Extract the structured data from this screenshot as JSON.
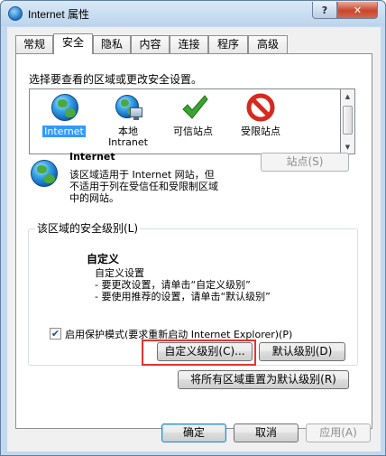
{
  "window": {
    "title": "Internet 属性",
    "help_label": "?",
    "close_label": "✕"
  },
  "tabs": [
    "常规",
    "安全",
    "隐私",
    "内容",
    "连接",
    "程序",
    "高级"
  ],
  "active_tab": "安全",
  "security": {
    "zone_prompt": "选择要查看的区域或更改安全设置。",
    "zones": [
      {
        "label_line1": "Internet",
        "label_line2": "",
        "icon": "globe-icon",
        "selected": true
      },
      {
        "label_line1": "本地",
        "label_line2": "Intranet",
        "icon": "local-intranet-icon",
        "selected": false
      },
      {
        "label_line1": "可信站点",
        "label_line2": "",
        "icon": "green-check-icon",
        "selected": false
      },
      {
        "label_line1": "受限站点",
        "label_line2": "",
        "icon": "restricted-icon",
        "selected": false
      }
    ],
    "selected_zone": {
      "name": "Internet",
      "description": [
        "该区域适用于 Internet 网站，但",
        "不适用于列在受信任和受限制区域",
        "中的网站。"
      ]
    },
    "sites_button": "站点(S)",
    "level_group": {
      "title": "该区域的安全级别(L)",
      "level_name": "自定义",
      "level_description": [
        "自定义设置",
        "- 要更改设置，请单击“自定义级别”",
        "- 要使用推荐的设置，请单击“默认级别”"
      ],
      "protected_mode_label": "启用保护模式(要求重新启动 Internet Explorer)(P)",
      "protected_mode_checked": true,
      "custom_level_button": "自定义级别(C)...",
      "default_level_button": "默认级别(D)"
    },
    "reset_all_button": "将所有区域重置为默认级别(R)"
  },
  "footer": {
    "ok": "确定",
    "cancel": "取消",
    "apply": "应用(A)"
  },
  "colors": {
    "selection": "#3399ff",
    "highlight_border": "#e6322f",
    "titlebar": "#c3d8ee"
  }
}
